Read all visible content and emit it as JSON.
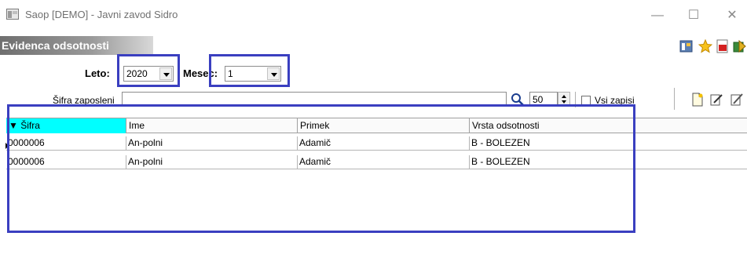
{
  "window": {
    "title": "Saop  [DEMO] - Javni zavod Sidro"
  },
  "module": {
    "title": "Evidenca odsotnosti"
  },
  "filters": {
    "leto_label": "Leto:",
    "leto_value": "2020",
    "mesec_label": "Mesec:",
    "mesec_value": "1",
    "sifra_label": "Šifra zaposleni",
    "sifra_value": "",
    "page_size": "50",
    "vsi_zapisi_label": "Vsi zapisi",
    "vsi_zapisi_checked": false
  },
  "table": {
    "columns": [
      "▼ Šifra",
      "Ime",
      "Primek",
      "Vrsta odsotnosti"
    ],
    "rows": [
      [
        "0000006",
        "An-polni",
        "Adamič",
        "B - BOLEZEN"
      ],
      [
        "0000006",
        "An-polni",
        "Adamič",
        "B - BOLEZEN"
      ]
    ]
  },
  "colors": {
    "highlight": "#3a3fc0",
    "active_column": "#00ffff"
  },
  "icons": [
    "app-icon",
    "minimize-icon",
    "maximize-icon",
    "close-icon",
    "layout-icon",
    "star-icon",
    "pdf-icon",
    "exit-icon",
    "search-icon",
    "new-document-icon",
    "edit-icon",
    "edit-alt-icon"
  ]
}
